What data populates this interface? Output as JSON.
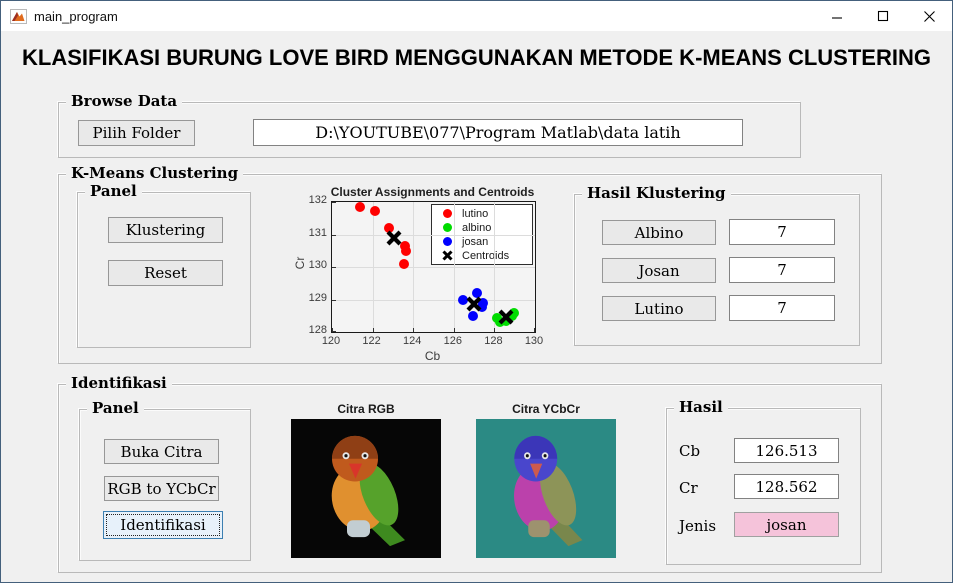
{
  "window": {
    "title": "main_program"
  },
  "heading": "KLASIFIKASI BURUNG LOVE BIRD MENGGUNAKAN METODE K-MEANS CLUSTERING",
  "browse": {
    "title": "Browse Data",
    "pilih_folder_label": "Pilih Folder",
    "path_value": "D:\\YOUTUBE\\077\\Program Matlab\\data latih"
  },
  "kmeans": {
    "title": "K-Means Clustering",
    "panel": {
      "title": "Panel",
      "klustering_label": "Klustering",
      "reset_label": "Reset"
    },
    "hasil": {
      "title": "Hasil Klustering",
      "rows": [
        {
          "label": "Albino",
          "value": "7"
        },
        {
          "label": "Josan",
          "value": "7"
        },
        {
          "label": "Lutino",
          "value": "7"
        }
      ]
    }
  },
  "chart_data": {
    "type": "scatter",
    "title": "Cluster Assignments and Centroids",
    "xlabel": "Cb",
    "ylabel": "Cr",
    "xlim": [
      120,
      130
    ],
    "ylim": [
      128,
      132
    ],
    "xticks": [
      120,
      122,
      124,
      126,
      128,
      130
    ],
    "yticks": [
      128,
      129,
      130,
      131,
      132
    ],
    "grid": true,
    "legend_position": "top-right",
    "series": [
      {
        "name": "lutino",
        "color": "#ff0000",
        "marker": "dot",
        "points": [
          [
            121.4,
            131.85
          ],
          [
            122.1,
            131.72
          ],
          [
            122.8,
            131.2
          ],
          [
            123.6,
            130.65
          ],
          [
            123.65,
            130.5
          ],
          [
            123.55,
            130.1
          ]
        ]
      },
      {
        "name": "albino",
        "color": "#00dc00",
        "marker": "dot",
        "points": [
          [
            128.15,
            128.42
          ],
          [
            128.3,
            128.3
          ],
          [
            128.55,
            128.35
          ],
          [
            128.85,
            128.5
          ],
          [
            128.95,
            128.57
          ]
        ]
      },
      {
        "name": "josan",
        "color": "#0000ff",
        "marker": "dot",
        "points": [
          [
            126.45,
            129.0
          ],
          [
            127.15,
            129.2
          ],
          [
            127.45,
            128.9
          ],
          [
            127.4,
            128.78
          ],
          [
            126.95,
            128.5
          ]
        ]
      },
      {
        "name": "Centroids",
        "color": "#000000",
        "marker": "x",
        "points": [
          [
            123.05,
            130.88
          ],
          [
            127.0,
            128.85
          ],
          [
            128.55,
            128.45
          ]
        ]
      }
    ]
  },
  "identifikasi": {
    "title": "Identifikasi",
    "panel": {
      "title": "Panel",
      "buka_citra_label": "Buka Citra",
      "rgb_to_ycbcr_label": "RGB to YCbCr",
      "identifikasi_label": "Identifikasi"
    },
    "citra_rgb_title": "Citra RGB",
    "citra_ycbcr_title": "Citra YCbCr",
    "hasil": {
      "title": "Hasil",
      "cb_label": "Cb",
      "cb_value": "126.513",
      "cr_label": "Cr",
      "cr_value": "128.562",
      "jenis_label": "Jenis",
      "jenis_value": "josan",
      "jenis_bg": "#f5c3da"
    }
  },
  "images": {
    "rgb": {
      "bg": "#060606",
      "head": "#c05a1d",
      "crown": "#8f3f15",
      "beak": "#d8352a",
      "chest": "#e0902f",
      "body": "#56a22b",
      "wing": "#3e8a1f",
      "foot": "#c2cdd2"
    },
    "ycbcr": {
      "bg": "#2b8a84",
      "head": "#4946cc",
      "crown": "#3b36b8",
      "beak": "#cd5a4e",
      "chest": "#bb41ab",
      "body": "#8d9458",
      "wing": "#79874c",
      "foot": "#9d926e"
    }
  }
}
